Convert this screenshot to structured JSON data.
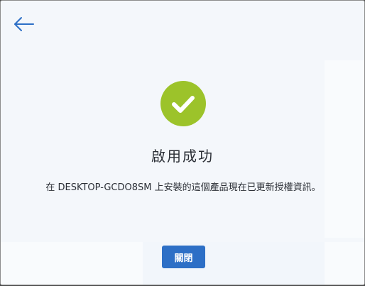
{
  "header": {
    "back_icon": "arrow-left-icon"
  },
  "status": {
    "icon": "checkmark-icon",
    "badge_color": "#9cc32a"
  },
  "content": {
    "title": "啟用成功",
    "message": "在 DESKTOP-GCDO8SM 上安裝的這個產品現在已更新授權資訊。"
  },
  "footer": {
    "close_label": "關閉",
    "button_color": "#2d6fc6"
  }
}
